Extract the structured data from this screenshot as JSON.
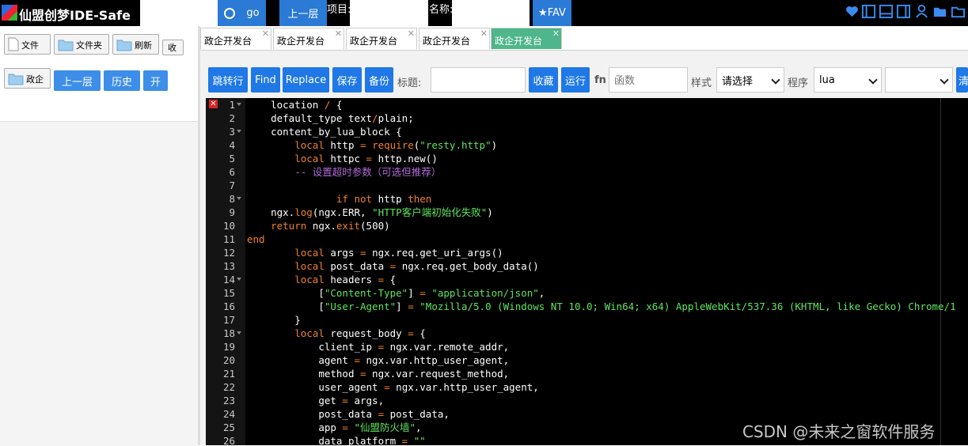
{
  "header": {
    "title": "仙盟创梦IDE-Safe",
    "search_value": "",
    "go_label": "go",
    "up_label": "上一层",
    "project_label": "项目:",
    "project_value": "",
    "name_label": "名称:",
    "name_value": "",
    "fav_label": "★FAV",
    "icons": [
      "heart-icon",
      "sidebar-left-icon",
      "panel-bottom-icon",
      "sidebar-right-icon",
      "user-icon",
      "user-icon",
      "folder-icon",
      "folder-icon"
    ]
  },
  "left": {
    "file_label": "文件",
    "folder_label": "文件夹",
    "refresh_label": "刷新",
    "collapse_label": "收",
    "folder_name_label": "政企",
    "up_label": "上一层",
    "history_label": "历史",
    "open_label": "开"
  },
  "tabs": [
    {
      "label": "政企开发台",
      "active": false
    },
    {
      "label": "政企开发台",
      "active": false
    },
    {
      "label": "政企开发台",
      "active": false
    },
    {
      "label": "政企开发台",
      "active": false
    },
    {
      "label": "政企开发台",
      "active": true
    }
  ],
  "toolbar": {
    "goto_label": "跳转行",
    "find_label": "Find",
    "replace_label": "Replace",
    "save_label": "保存",
    "backup_label": "备份",
    "title_label": "标题:",
    "title_value": "",
    "favorite_label": "收藏",
    "run_label": "运行",
    "fn_label": "fn",
    "function_placeholder": "函数",
    "style_label": "样式",
    "style_value": "请选择",
    "program_label": "程序",
    "program_value": "lua",
    "extra_value": "",
    "clear_label": "清"
  },
  "editor": {
    "error_line": 1,
    "lines": [
      {
        "n": "1",
        "fold": true,
        "indent": "    ",
        "tokens": [
          [
            "t",
            "location "
          ],
          [
            "kw",
            "/"
          ],
          [
            "t",
            " {"
          ]
        ]
      },
      {
        "n": "2",
        "fold": false,
        "indent": "    ",
        "tokens": [
          [
            "t",
            "default_type text"
          ],
          [
            "kw",
            "/"
          ],
          [
            "t",
            "plain;"
          ]
        ]
      },
      {
        "n": "3",
        "fold": true,
        "indent": "    ",
        "tokens": [
          [
            "t",
            "content_by_lua_block {"
          ]
        ]
      },
      {
        "n": "4",
        "fold": false,
        "indent": "        ",
        "tokens": [
          [
            "kw",
            "local"
          ],
          [
            "t",
            " http "
          ],
          [
            "kw",
            "="
          ],
          [
            "t",
            " "
          ],
          [
            "fn",
            "require"
          ],
          [
            "t",
            "("
          ],
          [
            "str",
            "\"resty.http\""
          ],
          [
            "t",
            ")"
          ]
        ]
      },
      {
        "n": "5",
        "fold": false,
        "indent": "        ",
        "tokens": [
          [
            "kw",
            "local"
          ],
          [
            "t",
            " httpc "
          ],
          [
            "kw",
            "="
          ],
          [
            "t",
            " http.new()"
          ]
        ]
      },
      {
        "n": "6",
        "fold": false,
        "indent": "        ",
        "tokens": [
          [
            "cmt",
            "-- 设置超时参数（可选但推荐）"
          ]
        ]
      },
      {
        "n": "7",
        "fold": false,
        "indent": "",
        "tokens": []
      },
      {
        "n": "8",
        "fold": true,
        "indent": "               ",
        "tokens": [
          [
            "kw",
            "if"
          ],
          [
            "t",
            " "
          ],
          [
            "kw",
            "not"
          ],
          [
            "t",
            " http "
          ],
          [
            "kw",
            "then"
          ]
        ]
      },
      {
        "n": "9",
        "fold": false,
        "indent": "    ",
        "tokens": [
          [
            "t",
            "ngx."
          ],
          [
            "fn",
            "log"
          ],
          [
            "t",
            "(ngx.ERR, "
          ],
          [
            "str",
            "\"HTTP客户端初始化失败\""
          ],
          [
            "t",
            ")"
          ]
        ]
      },
      {
        "n": "10",
        "fold": false,
        "indent": "    ",
        "tokens": [
          [
            "kw",
            "return"
          ],
          [
            "t",
            " ngx."
          ],
          [
            "fn",
            "exit"
          ],
          [
            "t",
            "(500)"
          ]
        ]
      },
      {
        "n": "11",
        "fold": false,
        "indent": "",
        "tokens": [
          [
            "kw",
            "end"
          ]
        ]
      },
      {
        "n": "12",
        "fold": false,
        "indent": "        ",
        "tokens": [
          [
            "kw",
            "local"
          ],
          [
            "t",
            " args "
          ],
          [
            "kw",
            "="
          ],
          [
            "t",
            " ngx.req.get_uri_args()"
          ]
        ]
      },
      {
        "n": "13",
        "fold": false,
        "indent": "        ",
        "tokens": [
          [
            "kw",
            "local"
          ],
          [
            "t",
            " post_data "
          ],
          [
            "kw",
            "="
          ],
          [
            "t",
            " ngx.req.get_body_data()"
          ]
        ]
      },
      {
        "n": "14",
        "fold": true,
        "indent": "        ",
        "tokens": [
          [
            "kw",
            "local"
          ],
          [
            "t",
            " headers "
          ],
          [
            "kw",
            "="
          ],
          [
            "t",
            " {"
          ]
        ]
      },
      {
        "n": "15",
        "fold": false,
        "indent": "            ",
        "tokens": [
          [
            "t",
            "["
          ],
          [
            "str",
            "\"Content-Type\""
          ],
          [
            "t",
            "] "
          ],
          [
            "kw",
            "="
          ],
          [
            "t",
            " "
          ],
          [
            "str",
            "\"application/json\""
          ],
          [
            "t",
            ","
          ]
        ]
      },
      {
        "n": "16",
        "fold": false,
        "indent": "            ",
        "tokens": [
          [
            "t",
            "["
          ],
          [
            "str",
            "\"User-Agent\""
          ],
          [
            "t",
            "] "
          ],
          [
            "kw",
            "="
          ],
          [
            "t",
            " "
          ],
          [
            "str",
            "\"Mozilla/5.0 (Windows NT 10.0; Win64; x64) AppleWebKit/537.36 (KHTML, like Gecko) Chrome/1"
          ]
        ]
      },
      {
        "n": "17",
        "fold": false,
        "indent": "        ",
        "tokens": [
          [
            "t",
            "}"
          ]
        ]
      },
      {
        "n": "18",
        "fold": true,
        "indent": "        ",
        "tokens": [
          [
            "kw",
            "local"
          ],
          [
            "t",
            " request_body "
          ],
          [
            "kw",
            "="
          ],
          [
            "t",
            " {"
          ]
        ]
      },
      {
        "n": "19",
        "fold": false,
        "indent": "            ",
        "tokens": [
          [
            "t",
            "client_ip "
          ],
          [
            "kw",
            "="
          ],
          [
            "t",
            " ngx.var.remote_addr,"
          ]
        ]
      },
      {
        "n": "20",
        "fold": false,
        "indent": "            ",
        "tokens": [
          [
            "t",
            "agent "
          ],
          [
            "kw",
            "="
          ],
          [
            "t",
            " ngx.var.http_user_agent,"
          ]
        ]
      },
      {
        "n": "21",
        "fold": false,
        "indent": "            ",
        "tokens": [
          [
            "t",
            "method "
          ],
          [
            "kw",
            "="
          ],
          [
            "t",
            " ngx.var.request_method,"
          ]
        ]
      },
      {
        "n": "22",
        "fold": false,
        "indent": "            ",
        "tokens": [
          [
            "t",
            "user_agent "
          ],
          [
            "kw",
            "="
          ],
          [
            "t",
            " ngx.var.http_user_agent,"
          ]
        ]
      },
      {
        "n": "23",
        "fold": false,
        "indent": "            ",
        "tokens": [
          [
            "t",
            "get "
          ],
          [
            "kw",
            "="
          ],
          [
            "t",
            " args,"
          ]
        ]
      },
      {
        "n": "24",
        "fold": false,
        "indent": "            ",
        "tokens": [
          [
            "t",
            "post_data "
          ],
          [
            "kw",
            "="
          ],
          [
            "t",
            " post_data,"
          ]
        ]
      },
      {
        "n": "25",
        "fold": false,
        "indent": "            ",
        "tokens": [
          [
            "t",
            "app "
          ],
          [
            "kw",
            "="
          ],
          [
            "t",
            " "
          ],
          [
            "str",
            "\"仙盟防火墙\""
          ],
          [
            "t",
            ","
          ]
        ]
      },
      {
        "n": "26",
        "fold": false,
        "indent": "            ",
        "tokens": [
          [
            "t",
            "data_platform "
          ],
          [
            "kw",
            "="
          ],
          [
            "t",
            " "
          ],
          [
            "str",
            "\"\""
          ]
        ]
      }
    ]
  },
  "watermark": "CSDN @未来之窗软件服务",
  "colors": {
    "accent": "#1f78e6",
    "active_tab": "#4fb58a",
    "keyword": "#f0802c",
    "string": "#5ee55e",
    "comment": "#b06bd8",
    "editor_bg": "#000000"
  }
}
